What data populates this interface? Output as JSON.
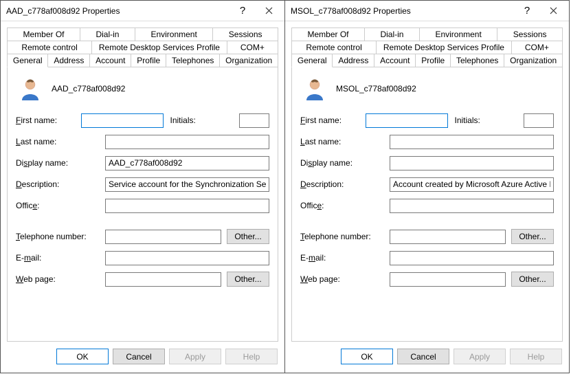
{
  "dialogs": [
    {
      "title": "AAD_c778af008d92 Properties",
      "username": "AAD_c778af008d92",
      "fields": {
        "first_name": "",
        "initials": "",
        "last_name": "",
        "display_name": "AAD_c778af008d92",
        "description": "Service account for the Synchronization Service with",
        "office": "",
        "telephone": "",
        "email": "",
        "web_page": ""
      }
    },
    {
      "title": "MSOL_c778af008d92 Properties",
      "username": "MSOL_c778af008d92",
      "fields": {
        "first_name": "",
        "initials": "",
        "last_name": "",
        "display_name": "",
        "description": "Account created by Microsoft Azure Active Directory",
        "office": "",
        "telephone": "",
        "email": "",
        "web_page": ""
      }
    }
  ],
  "tabs_row0": [
    "Member Of",
    "Dial-in",
    "Environment",
    "Sessions"
  ],
  "tabs_row1": [
    "Remote control",
    "Remote Desktop Services Profile",
    "COM+"
  ],
  "tabs_row2": [
    "General",
    "Address",
    "Account",
    "Profile",
    "Telephones",
    "Organization"
  ],
  "labels": {
    "first_name": "First name:",
    "initials": "Initials:",
    "last_name": "Last name:",
    "display_name": "Display name:",
    "description": "Description:",
    "office": "Office:",
    "telephone": "Telephone number:",
    "email": "E-mail:",
    "web_page": "Web page:",
    "other": "Other..."
  },
  "buttons": {
    "ok": "OK",
    "cancel": "Cancel",
    "apply": "Apply",
    "help": "Help"
  },
  "titlebar": {
    "help": "?",
    "close": "✕"
  }
}
